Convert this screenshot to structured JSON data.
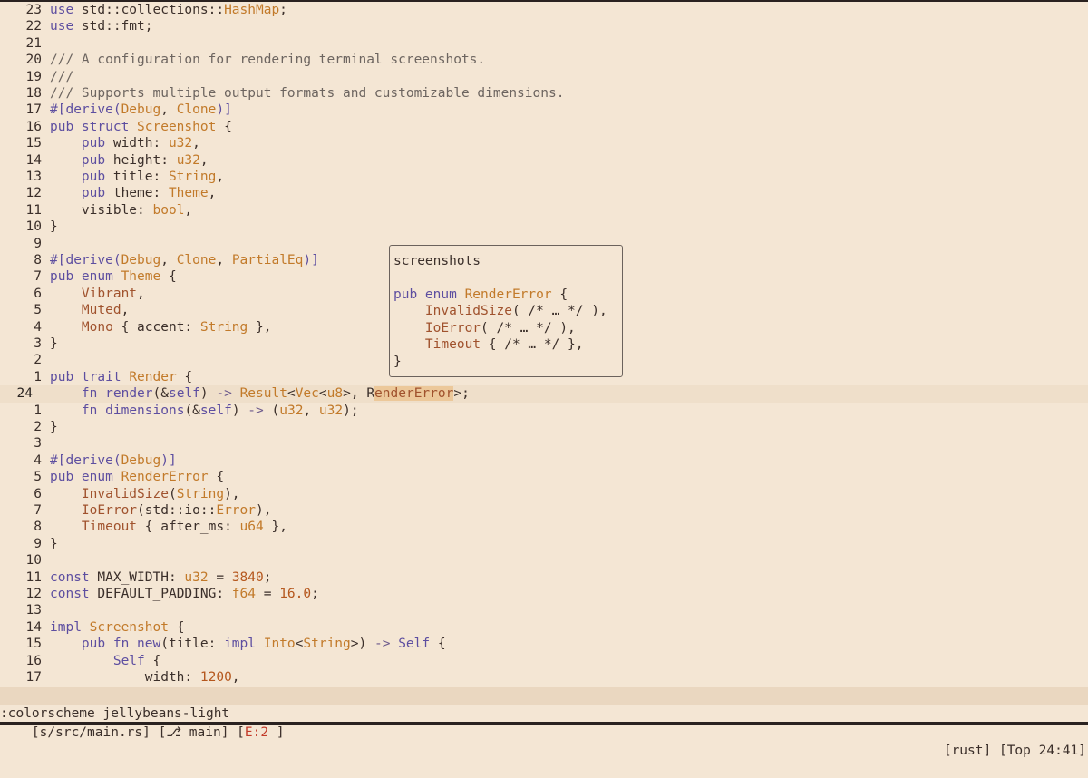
{
  "editor": {
    "lines": [
      {
        "n": "23",
        "t": [
          [
            "kw",
            "use "
          ],
          [
            "pl",
            "std::collections::"
          ],
          [
            "ty",
            "HashMap"
          ],
          [
            "pl",
            ";"
          ]
        ]
      },
      {
        "n": "22",
        "t": [
          [
            "kw",
            "use "
          ],
          [
            "pl",
            "std::fmt;"
          ]
        ]
      },
      {
        "n": "21",
        "t": []
      },
      {
        "n": "20",
        "t": [
          [
            "cm",
            "/// A configuration for rendering terminal screenshots."
          ]
        ]
      },
      {
        "n": "19",
        "t": [
          [
            "cm",
            "///"
          ]
        ]
      },
      {
        "n": "18",
        "t": [
          [
            "cm",
            "/// Supports multiple output formats and customizable dimensions."
          ]
        ]
      },
      {
        "n": "17",
        "t": [
          [
            "at",
            "#[derive("
          ],
          [
            "ty",
            "Debug"
          ],
          [
            "pl",
            ", "
          ],
          [
            "ty",
            "Clone"
          ],
          [
            "at",
            ")]"
          ]
        ]
      },
      {
        "n": "16",
        "t": [
          [
            "kw",
            "pub struct "
          ],
          [
            "ty",
            "Screenshot"
          ],
          [
            "pl",
            " {"
          ]
        ]
      },
      {
        "n": "15",
        "t": [
          [
            "pl",
            "    "
          ],
          [
            "kw",
            "pub "
          ],
          [
            "id",
            "width: "
          ],
          [
            "ty",
            "u32"
          ],
          [
            "pl",
            ","
          ]
        ]
      },
      {
        "n": "14",
        "t": [
          [
            "pl",
            "    "
          ],
          [
            "kw",
            "pub "
          ],
          [
            "id",
            "height: "
          ],
          [
            "ty",
            "u32"
          ],
          [
            "pl",
            ","
          ]
        ]
      },
      {
        "n": "13",
        "t": [
          [
            "pl",
            "    "
          ],
          [
            "kw",
            "pub "
          ],
          [
            "id",
            "title: "
          ],
          [
            "ty",
            "String"
          ],
          [
            "pl",
            ","
          ]
        ]
      },
      {
        "n": "12",
        "t": [
          [
            "pl",
            "    "
          ],
          [
            "kw",
            "pub "
          ],
          [
            "id",
            "theme: "
          ],
          [
            "ty",
            "Theme"
          ],
          [
            "pl",
            ","
          ]
        ]
      },
      {
        "n": "11",
        "t": [
          [
            "pl",
            "    "
          ],
          [
            "id",
            "visible: "
          ],
          [
            "ty",
            "bool"
          ],
          [
            "pl",
            ","
          ]
        ]
      },
      {
        "n": "10",
        "t": [
          [
            "pl",
            "}"
          ]
        ]
      },
      {
        "n": "9",
        "t": []
      },
      {
        "n": "8",
        "t": [
          [
            "at",
            "#[derive("
          ],
          [
            "ty",
            "Debug"
          ],
          [
            "pl",
            ", "
          ],
          [
            "ty",
            "Clone"
          ],
          [
            "pl",
            ", "
          ],
          [
            "ty",
            "PartialEq"
          ],
          [
            "at",
            ")]"
          ]
        ]
      },
      {
        "n": "7",
        "t": [
          [
            "kw",
            "pub enum "
          ],
          [
            "ty",
            "Theme"
          ],
          [
            "pl",
            " {"
          ]
        ]
      },
      {
        "n": "6",
        "t": [
          [
            "pl",
            "    "
          ],
          [
            "va",
            "Vibrant"
          ],
          [
            "pl",
            ","
          ]
        ]
      },
      {
        "n": "5",
        "t": [
          [
            "pl",
            "    "
          ],
          [
            "va",
            "Muted"
          ],
          [
            "pl",
            ","
          ]
        ]
      },
      {
        "n": "4",
        "t": [
          [
            "pl",
            "    "
          ],
          [
            "va",
            "Mono"
          ],
          [
            "pl",
            " { "
          ],
          [
            "id",
            "accent: "
          ],
          [
            "ty",
            "String"
          ],
          [
            "pl",
            " },"
          ]
        ]
      },
      {
        "n": "3",
        "t": [
          [
            "pl",
            "}"
          ]
        ]
      },
      {
        "n": "2",
        "t": []
      },
      {
        "n": "1",
        "t": [
          [
            "kw",
            "pub trait "
          ],
          [
            "ty",
            "Render"
          ],
          [
            "pl",
            " {"
          ]
        ]
      },
      {
        "n": "24",
        "current": true,
        "t": [
          [
            "pl",
            "    "
          ],
          [
            "kw",
            "fn "
          ],
          [
            "fn",
            "render"
          ],
          [
            "pl",
            "(&"
          ],
          [
            "kw",
            "self"
          ],
          [
            "pl",
            ") "
          ],
          [
            "op",
            "->"
          ],
          [
            "pl",
            " "
          ],
          [
            "ty",
            "Result"
          ],
          [
            "pl",
            "<"
          ],
          [
            "ty",
            "Vec"
          ],
          [
            "pl",
            "<"
          ],
          [
            "ty",
            "u8"
          ],
          [
            "pl",
            ">, "
          ],
          [
            "pl",
            "R"
          ],
          [
            "hl",
            "enderError"
          ],
          [
            "pl",
            ">;"
          ]
        ]
      },
      {
        "n": "1",
        "t": [
          [
            "pl",
            "    "
          ],
          [
            "kw",
            "fn "
          ],
          [
            "fn",
            "dimensions"
          ],
          [
            "pl",
            "(&"
          ],
          [
            "kw",
            "self"
          ],
          [
            "pl",
            ") "
          ],
          [
            "op",
            "->"
          ],
          [
            "pl",
            " ("
          ],
          [
            "ty",
            "u32"
          ],
          [
            "pl",
            ", "
          ],
          [
            "ty",
            "u32"
          ],
          [
            "pl",
            ");"
          ]
        ]
      },
      {
        "n": "2",
        "t": [
          [
            "pl",
            "}"
          ]
        ]
      },
      {
        "n": "3",
        "t": []
      },
      {
        "n": "4",
        "t": [
          [
            "at",
            "#[derive("
          ],
          [
            "ty",
            "Debug"
          ],
          [
            "at",
            ")]"
          ]
        ]
      },
      {
        "n": "5",
        "t": [
          [
            "kw",
            "pub enum "
          ],
          [
            "ty",
            "RenderError"
          ],
          [
            "pl",
            " {"
          ]
        ]
      },
      {
        "n": "6",
        "t": [
          [
            "pl",
            "    "
          ],
          [
            "va",
            "InvalidSize"
          ],
          [
            "pl",
            "("
          ],
          [
            "ty",
            "String"
          ],
          [
            "pl",
            "),"
          ]
        ]
      },
      {
        "n": "7",
        "t": [
          [
            "pl",
            "    "
          ],
          [
            "va",
            "IoError"
          ],
          [
            "pl",
            "(std::io::"
          ],
          [
            "ty",
            "Error"
          ],
          [
            "pl",
            "),"
          ]
        ]
      },
      {
        "n": "8",
        "t": [
          [
            "pl",
            "    "
          ],
          [
            "va",
            "Timeout"
          ],
          [
            "pl",
            " { "
          ],
          [
            "id",
            "after_ms: "
          ],
          [
            "ty",
            "u64"
          ],
          [
            "pl",
            " },"
          ]
        ]
      },
      {
        "n": "9",
        "t": [
          [
            "pl",
            "}"
          ]
        ]
      },
      {
        "n": "10",
        "t": []
      },
      {
        "n": "11",
        "t": [
          [
            "kw",
            "const "
          ],
          [
            "id",
            "MAX_WIDTH: "
          ],
          [
            "ty",
            "u32"
          ],
          [
            "pl",
            " = "
          ],
          [
            "nu",
            "3840"
          ],
          [
            "pl",
            ";"
          ]
        ]
      },
      {
        "n": "12",
        "t": [
          [
            "kw",
            "const "
          ],
          [
            "id",
            "DEFAULT_PADDING: "
          ],
          [
            "ty",
            "f64"
          ],
          [
            "pl",
            " = "
          ],
          [
            "nu",
            "16.0"
          ],
          [
            "pl",
            ";"
          ]
        ]
      },
      {
        "n": "13",
        "t": []
      },
      {
        "n": "14",
        "t": [
          [
            "kw",
            "impl "
          ],
          [
            "ty",
            "Screenshot"
          ],
          [
            "pl",
            " {"
          ]
        ]
      },
      {
        "n": "15",
        "t": [
          [
            "pl",
            "    "
          ],
          [
            "kw",
            "pub fn "
          ],
          [
            "fn",
            "new"
          ],
          [
            "pl",
            "(title: "
          ],
          [
            "kw",
            "impl "
          ],
          [
            "ty",
            "Into"
          ],
          [
            "pl",
            "<"
          ],
          [
            "ty",
            "String"
          ],
          [
            "pl",
            ">) "
          ],
          [
            "op",
            "->"
          ],
          [
            "pl",
            " "
          ],
          [
            "kw",
            "Self"
          ],
          [
            "pl",
            " {"
          ]
        ]
      },
      {
        "n": "16",
        "t": [
          [
            "pl",
            "        "
          ],
          [
            "kw",
            "Self"
          ],
          [
            "pl",
            " {"
          ]
        ]
      },
      {
        "n": "17",
        "t": [
          [
            "pl",
            "            "
          ],
          [
            "id",
            "width: "
          ],
          [
            "nu",
            "1200"
          ],
          [
            "pl",
            ","
          ]
        ]
      }
    ]
  },
  "hover_popup": {
    "title": "screenshots",
    "lines": [
      [
        [
          "kw",
          "pub enum "
        ],
        [
          "ty",
          "RenderError"
        ],
        [
          "pl",
          " {"
        ]
      ],
      [
        [
          "pl",
          "    "
        ],
        [
          "va",
          "InvalidSize"
        ],
        [
          "pl",
          "( /* … */ ),"
        ]
      ],
      [
        [
          "pl",
          "    "
        ],
        [
          "va",
          "IoError"
        ],
        [
          "pl",
          "( /* … */ ),"
        ]
      ],
      [
        [
          "pl",
          "    "
        ],
        [
          "va",
          "Timeout"
        ],
        [
          "pl",
          " { /* … */ },"
        ]
      ],
      [
        [
          "pl",
          "}"
        ]
      ]
    ]
  },
  "statusline": {
    "file": "[s/src/main.rs]",
    "branch": "[⎇ main]",
    "errors_open": "[",
    "errors": "E:2",
    "errors_close": " ]",
    "filetype": "[rust]",
    "position": "[Top 24:41]"
  },
  "cmdline": {
    "text": ":colorscheme jellybeans-light"
  }
}
